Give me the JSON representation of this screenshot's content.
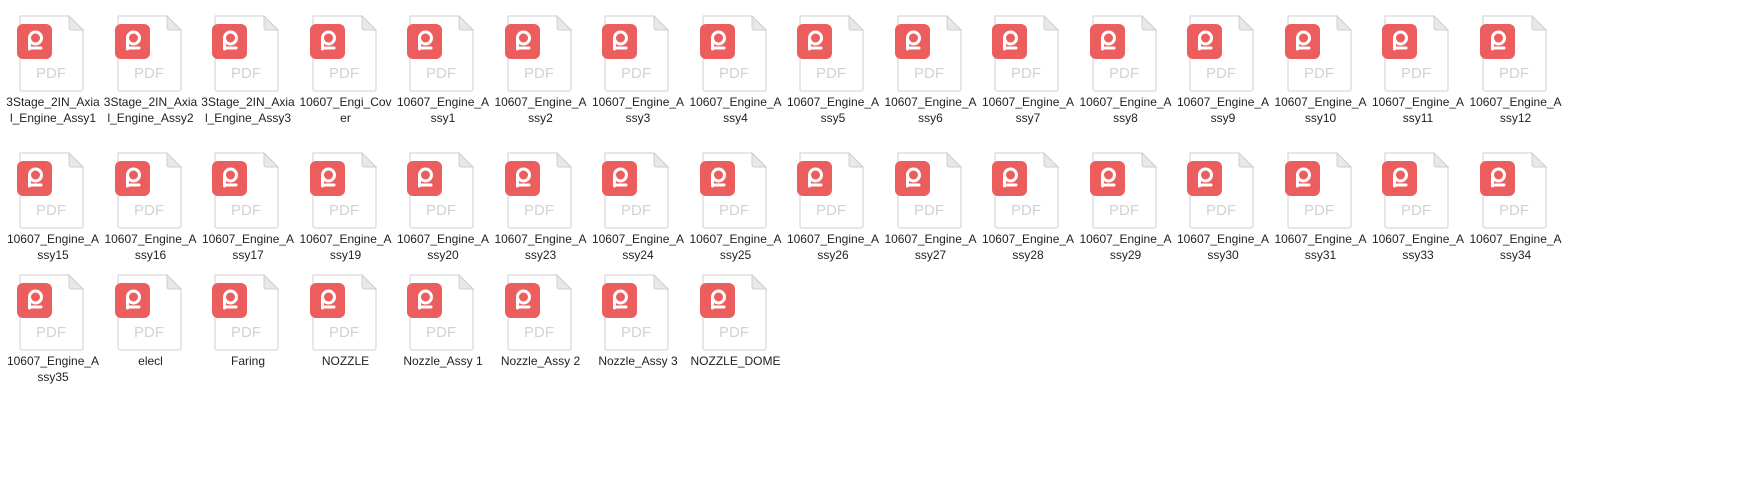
{
  "files": [
    {
      "name": "3Stage_2IN_Axial_Engine_Assy1",
      "icon": "pdf-file-icon",
      "badge_text": "PDF"
    },
    {
      "name": "3Stage_2IN_Axial_Engine_Assy2",
      "icon": "pdf-file-icon",
      "badge_text": "PDF"
    },
    {
      "name": "3Stage_2IN_Axial_Engine_Assy3",
      "icon": "pdf-file-icon",
      "badge_text": "PDF"
    },
    {
      "name": "10607_Engi_Cover",
      "icon": "pdf-file-icon",
      "badge_text": "PDF"
    },
    {
      "name": "10607_Engine_Assy1",
      "icon": "pdf-file-icon",
      "badge_text": "PDF"
    },
    {
      "name": "10607_Engine_Assy2",
      "icon": "pdf-file-icon",
      "badge_text": "PDF"
    },
    {
      "name": "10607_Engine_Assy3",
      "icon": "pdf-file-icon",
      "badge_text": "PDF"
    },
    {
      "name": "10607_Engine_Assy4",
      "icon": "pdf-file-icon",
      "badge_text": "PDF"
    },
    {
      "name": "10607_Engine_Assy5",
      "icon": "pdf-file-icon",
      "badge_text": "PDF"
    },
    {
      "name": "10607_Engine_Assy6",
      "icon": "pdf-file-icon",
      "badge_text": "PDF"
    },
    {
      "name": "10607_Engine_Assy7",
      "icon": "pdf-file-icon",
      "badge_text": "PDF"
    },
    {
      "name": "10607_Engine_Assy8",
      "icon": "pdf-file-icon",
      "badge_text": "PDF"
    },
    {
      "name": "10607_Engine_Assy9",
      "icon": "pdf-file-icon",
      "badge_text": "PDF"
    },
    {
      "name": "10607_Engine_Assy10",
      "icon": "pdf-file-icon",
      "badge_text": "PDF"
    },
    {
      "name": "10607_Engine_Assy11",
      "icon": "pdf-file-icon",
      "badge_text": "PDF"
    },
    {
      "name": "10607_Engine_Assy12",
      "icon": "pdf-file-icon",
      "badge_text": "PDF"
    },
    {
      "name": "10607_Engine_Assy15",
      "icon": "pdf-file-icon",
      "badge_text": "PDF"
    },
    {
      "name": "10607_Engine_Assy16",
      "icon": "pdf-file-icon",
      "badge_text": "PDF"
    },
    {
      "name": "10607_Engine_Assy17",
      "icon": "pdf-file-icon",
      "badge_text": "PDF"
    },
    {
      "name": "10607_Engine_Assy19",
      "icon": "pdf-file-icon",
      "badge_text": "PDF"
    },
    {
      "name": "10607_Engine_Assy20",
      "icon": "pdf-file-icon",
      "badge_text": "PDF"
    },
    {
      "name": "10607_Engine_Assy23",
      "icon": "pdf-file-icon",
      "badge_text": "PDF"
    },
    {
      "name": "10607_Engine_Assy24",
      "icon": "pdf-file-icon",
      "badge_text": "PDF"
    },
    {
      "name": "10607_Engine_Assy25",
      "icon": "pdf-file-icon",
      "badge_text": "PDF"
    },
    {
      "name": "10607_Engine_Assy26",
      "icon": "pdf-file-icon",
      "badge_text": "PDF"
    },
    {
      "name": "10607_Engine_Assy27",
      "icon": "pdf-file-icon",
      "badge_text": "PDF"
    },
    {
      "name": "10607_Engine_Assy28",
      "icon": "pdf-file-icon",
      "badge_text": "PDF"
    },
    {
      "name": "10607_Engine_Assy29",
      "icon": "pdf-file-icon",
      "badge_text": "PDF"
    },
    {
      "name": "10607_Engine_Assy30",
      "icon": "pdf-file-icon",
      "badge_text": "PDF"
    },
    {
      "name": "10607_Engine_Assy31",
      "icon": "pdf-file-icon",
      "badge_text": "PDF"
    },
    {
      "name": "10607_Engine_Assy33",
      "icon": "pdf-file-icon",
      "badge_text": "PDF"
    },
    {
      "name": "10607_Engine_Assy34",
      "icon": "pdf-file-icon",
      "badge_text": "PDF"
    },
    {
      "name": "10607_Engine_Assy35",
      "icon": "pdf-file-icon",
      "badge_text": "PDF"
    },
    {
      "name": "elecl",
      "icon": "pdf-file-icon",
      "badge_text": "PDF"
    },
    {
      "name": "Faring",
      "icon": "pdf-file-icon",
      "badge_text": "PDF"
    },
    {
      "name": "NOZZLE",
      "icon": "pdf-file-icon",
      "badge_text": "PDF"
    },
    {
      "name": "Nozzle_Assy 1",
      "icon": "pdf-file-icon",
      "badge_text": "PDF"
    },
    {
      "name": "Nozzle_Assy 2",
      "icon": "pdf-file-icon",
      "badge_text": "PDF"
    },
    {
      "name": "Nozzle_Assy 3",
      "icon": "pdf-file-icon",
      "badge_text": "PDF"
    },
    {
      "name": "NOZZLE_DOME",
      "icon": "pdf-file-icon",
      "badge_text": "PDF"
    }
  ],
  "colors": {
    "badge": "#ec5d5d",
    "page": "#ffffff",
    "page_border": "#cfcfcf",
    "fold": "#e8e8e8",
    "pdf_text": "#d2d2d2",
    "label": "#1f1f1f"
  }
}
